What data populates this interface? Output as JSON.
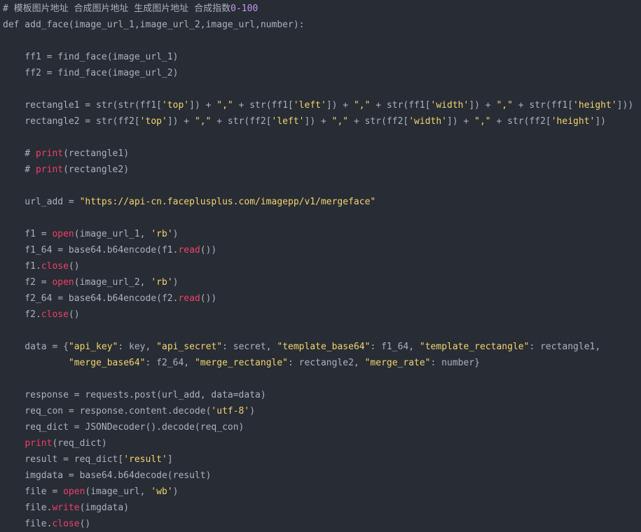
{
  "theme": {
    "background": "#282c34",
    "plain": "#abb2bf",
    "string": "#f1d570",
    "builtin": "#f0406b",
    "number": "#c397f2"
  },
  "code": {
    "language": "python",
    "lines": [
      [
        {
          "t": "comment",
          "v": "# 模板图片地址 合成图片地址 生成图片地址 合成指数"
        },
        {
          "t": "number",
          "v": "0-100"
        }
      ],
      [
        {
          "t": "plain",
          "v": "def add_face(image_url_1,image_url_2,image_url,number):"
        }
      ],
      [],
      [
        {
          "t": "plain",
          "v": "    ff1 = find_face(image_url_1)"
        }
      ],
      [
        {
          "t": "plain",
          "v": "    ff2 = find_face(image_url_2)"
        }
      ],
      [],
      [
        {
          "t": "plain",
          "v": "    rectangle1 = str(str(ff1["
        },
        {
          "t": "string",
          "v": "'top'"
        },
        {
          "t": "plain",
          "v": "]) + "
        },
        {
          "t": "string",
          "v": "\",\""
        },
        {
          "t": "plain",
          "v": " + str(ff1["
        },
        {
          "t": "string",
          "v": "'left'"
        },
        {
          "t": "plain",
          "v": "]) + "
        },
        {
          "t": "string",
          "v": "\",\""
        },
        {
          "t": "plain",
          "v": " + str(ff1["
        },
        {
          "t": "string",
          "v": "'width'"
        },
        {
          "t": "plain",
          "v": "]) + "
        },
        {
          "t": "string",
          "v": "\",\""
        },
        {
          "t": "plain",
          "v": " + str(ff1["
        },
        {
          "t": "string",
          "v": "'height'"
        },
        {
          "t": "plain",
          "v": "]))"
        }
      ],
      [
        {
          "t": "plain",
          "v": "    rectangle2 = str(ff2["
        },
        {
          "t": "string",
          "v": "'top'"
        },
        {
          "t": "plain",
          "v": "]) + "
        },
        {
          "t": "string",
          "v": "\",\""
        },
        {
          "t": "plain",
          "v": " + str(ff2["
        },
        {
          "t": "string",
          "v": "'left'"
        },
        {
          "t": "plain",
          "v": "]) + "
        },
        {
          "t": "string",
          "v": "\",\""
        },
        {
          "t": "plain",
          "v": " + str(ff2["
        },
        {
          "t": "string",
          "v": "'width'"
        },
        {
          "t": "plain",
          "v": "]) + "
        },
        {
          "t": "string",
          "v": "\",\""
        },
        {
          "t": "plain",
          "v": " + str(ff2["
        },
        {
          "t": "string",
          "v": "'height'"
        },
        {
          "t": "plain",
          "v": "])"
        }
      ],
      [],
      [
        {
          "t": "comment",
          "v": "    # "
        },
        {
          "t": "builtin",
          "v": "print"
        },
        {
          "t": "plain",
          "v": "(rectangle1)"
        }
      ],
      [
        {
          "t": "comment",
          "v": "    # "
        },
        {
          "t": "builtin",
          "v": "print"
        },
        {
          "t": "plain",
          "v": "(rectangle2)"
        }
      ],
      [],
      [
        {
          "t": "plain",
          "v": "    url_add = "
        },
        {
          "t": "string",
          "v": "\"https://api-cn.faceplusplus.com/imagepp/v1/mergeface\""
        }
      ],
      [],
      [
        {
          "t": "plain",
          "v": "    f1 = "
        },
        {
          "t": "builtin",
          "v": "open"
        },
        {
          "t": "plain",
          "v": "(image_url_1, "
        },
        {
          "t": "string",
          "v": "'rb'"
        },
        {
          "t": "plain",
          "v": ")"
        }
      ],
      [
        {
          "t": "plain",
          "v": "    f1_64 = base64.b64encode(f1."
        },
        {
          "t": "builtin",
          "v": "read"
        },
        {
          "t": "plain",
          "v": "())"
        }
      ],
      [
        {
          "t": "plain",
          "v": "    f1."
        },
        {
          "t": "builtin",
          "v": "close"
        },
        {
          "t": "plain",
          "v": "()"
        }
      ],
      [
        {
          "t": "plain",
          "v": "    f2 = "
        },
        {
          "t": "builtin",
          "v": "open"
        },
        {
          "t": "plain",
          "v": "(image_url_2, "
        },
        {
          "t": "string",
          "v": "'rb'"
        },
        {
          "t": "plain",
          "v": ")"
        }
      ],
      [
        {
          "t": "plain",
          "v": "    f2_64 = base64.b64encode(f2."
        },
        {
          "t": "builtin",
          "v": "read"
        },
        {
          "t": "plain",
          "v": "())"
        }
      ],
      [
        {
          "t": "plain",
          "v": "    f2."
        },
        {
          "t": "builtin",
          "v": "close"
        },
        {
          "t": "plain",
          "v": "()"
        }
      ],
      [],
      [
        {
          "t": "plain",
          "v": "    data = {"
        },
        {
          "t": "string",
          "v": "\"api_key\""
        },
        {
          "t": "plain",
          "v": ": key, "
        },
        {
          "t": "string",
          "v": "\"api_secret\""
        },
        {
          "t": "plain",
          "v": ": secret, "
        },
        {
          "t": "string",
          "v": "\"template_base64\""
        },
        {
          "t": "plain",
          "v": ": f1_64, "
        },
        {
          "t": "string",
          "v": "\"template_rectangle\""
        },
        {
          "t": "plain",
          "v": ": rectangle1,"
        }
      ],
      [
        {
          "t": "plain",
          "v": "            "
        },
        {
          "t": "string",
          "v": "\"merge_base64\""
        },
        {
          "t": "plain",
          "v": ": f2_64, "
        },
        {
          "t": "string",
          "v": "\"merge_rectangle\""
        },
        {
          "t": "plain",
          "v": ": rectangle2, "
        },
        {
          "t": "string",
          "v": "\"merge_rate\""
        },
        {
          "t": "plain",
          "v": ": number}"
        }
      ],
      [],
      [
        {
          "t": "plain",
          "v": "    response = requests.post(url_add, data=data)"
        }
      ],
      [
        {
          "t": "plain",
          "v": "    req_con = response.content.decode("
        },
        {
          "t": "string",
          "v": "'utf-8'"
        },
        {
          "t": "plain",
          "v": ")"
        }
      ],
      [
        {
          "t": "plain",
          "v": "    req_dict = JSONDecoder().decode(req_con)"
        }
      ],
      [
        {
          "t": "plain",
          "v": "    "
        },
        {
          "t": "builtin",
          "v": "print"
        },
        {
          "t": "plain",
          "v": "(req_dict)"
        }
      ],
      [
        {
          "t": "plain",
          "v": "    result = req_dict["
        },
        {
          "t": "string",
          "v": "'result'"
        },
        {
          "t": "plain",
          "v": "]"
        }
      ],
      [
        {
          "t": "plain",
          "v": "    imgdata = base64.b64decode(result)"
        }
      ],
      [
        {
          "t": "plain",
          "v": "    file = "
        },
        {
          "t": "builtin",
          "v": "open"
        },
        {
          "t": "plain",
          "v": "(image_url, "
        },
        {
          "t": "string",
          "v": "'wb'"
        },
        {
          "t": "plain",
          "v": ")"
        }
      ],
      [
        {
          "t": "plain",
          "v": "    file."
        },
        {
          "t": "builtin",
          "v": "write"
        },
        {
          "t": "plain",
          "v": "(imgdata)"
        }
      ],
      [
        {
          "t": "plain",
          "v": "    file."
        },
        {
          "t": "builtin",
          "v": "close"
        },
        {
          "t": "plain",
          "v": "()"
        }
      ]
    ]
  }
}
